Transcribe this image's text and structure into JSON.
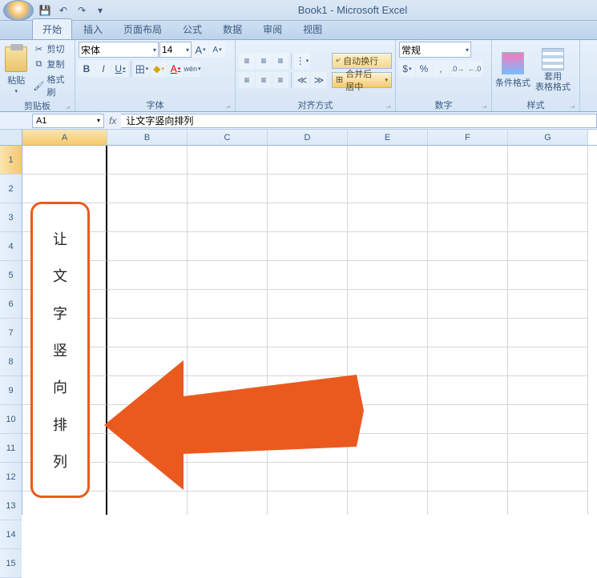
{
  "title": "Book1 - Microsoft Excel",
  "qat": {
    "save": "💾",
    "undo": "↶",
    "redo": "↷",
    "more": "▾"
  },
  "tabs": [
    "开始",
    "插入",
    "页面布局",
    "公式",
    "数据",
    "审阅",
    "视图"
  ],
  "active_tab": 0,
  "ribbon": {
    "clipboard": {
      "label": "剪贴板",
      "paste": "粘贴",
      "cut": "剪切",
      "copy": "复制",
      "format_painter": "格式刷"
    },
    "font": {
      "label": "字体",
      "name": "宋体",
      "size": "14",
      "increase": "A",
      "decrease": "A",
      "bold": "B",
      "italic": "I",
      "underline": "U",
      "border": "田",
      "fill": "◆",
      "color": "A",
      "phonetic": "wén"
    },
    "alignment": {
      "label": "对齐方式",
      "wrap": "自动换行",
      "merge": "合并后居中"
    },
    "number": {
      "label": "数字",
      "format": "常规",
      "currency": "$",
      "percent": "%",
      "comma": ",",
      "inc_dec": ".0",
      "dec_dec": ".0"
    },
    "styles": {
      "label": "样式",
      "conditional": "条件格式",
      "table": "套用\n表格格式"
    }
  },
  "name_box": "A1",
  "formula": "让文字竖向排列",
  "columns": [
    "A",
    "B",
    "C",
    "D",
    "E",
    "F",
    "G"
  ],
  "rows": [
    "1",
    "2",
    "3",
    "4",
    "5",
    "6",
    "7",
    "8",
    "9",
    "10",
    "11",
    "12",
    "13",
    "14",
    "15"
  ],
  "vertical_text": [
    "让",
    "文",
    "字",
    "竖",
    "向",
    "排",
    "列"
  ],
  "icons": {
    "cut": "✂",
    "copy": "⧉",
    "brush": "🖌",
    "align_tl": "≡",
    "align_tc": "≡",
    "align_tr": "≡",
    "indent_dec": "≪",
    "indent_inc": "≫",
    "orient": "⟳"
  }
}
